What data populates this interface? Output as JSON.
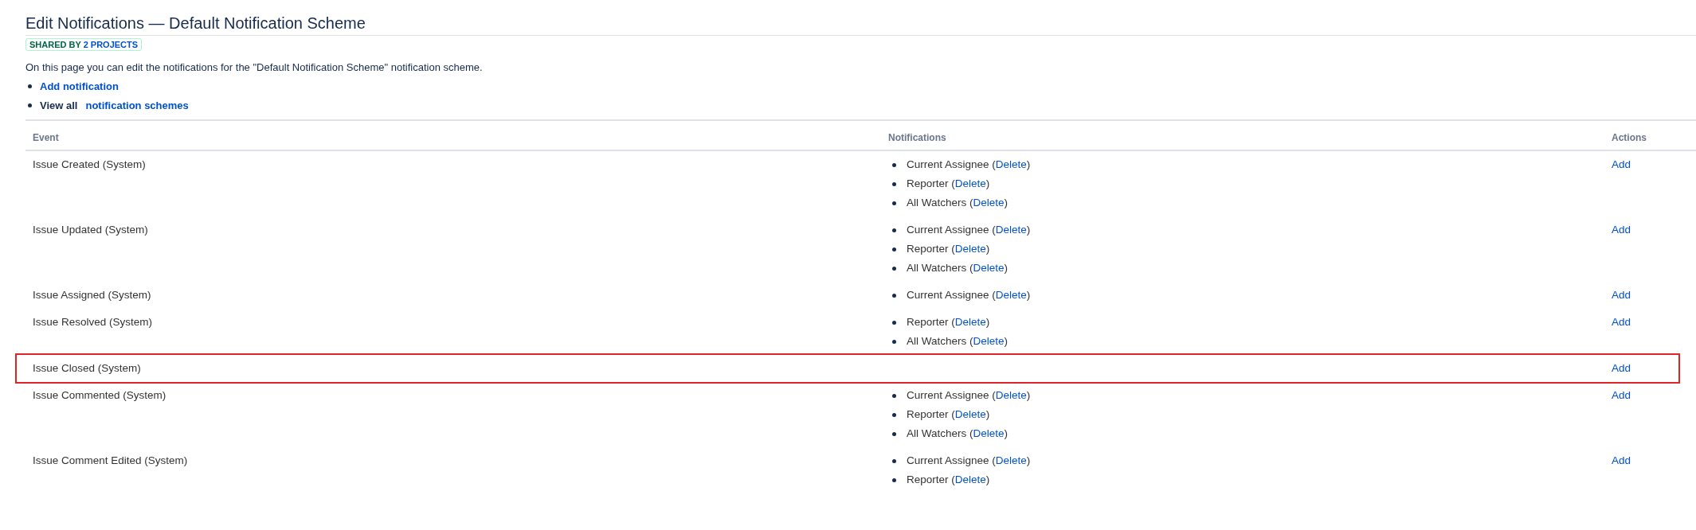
{
  "title": "Edit Notifications — Default Notification Scheme",
  "lozenge": {
    "label": "SHARED BY",
    "link": "2 PROJECTS"
  },
  "description": "On this page you can edit the notifications for the \"Default Notification Scheme\" notification scheme.",
  "links": [
    {
      "link": "Add notification"
    },
    {
      "prefix": "View all",
      "link": "notification schemes"
    }
  ],
  "table": {
    "columns": [
      "Event",
      "Notifications",
      "Actions"
    ],
    "rows": [
      {
        "event": "Issue Created (System)",
        "highlighted": false,
        "notifications": [
          {
            "name": "Current Assignee",
            "open": "(",
            "action": "Delete",
            "close": ")"
          },
          {
            "name": "Reporter",
            "open": "(",
            "action": "Delete",
            "close": ")"
          },
          {
            "name": "All Watchers",
            "open": "(",
            "action": "Delete",
            "close": ")"
          }
        ],
        "action": "Add"
      },
      {
        "event": "Issue Updated (System)",
        "highlighted": false,
        "notifications": [
          {
            "name": "Current Assignee",
            "open": "(",
            "action": "Delete",
            "close": ")"
          },
          {
            "name": "Reporter",
            "open": "(",
            "action": "Delete",
            "close": ")"
          },
          {
            "name": "All Watchers",
            "open": "(",
            "action": "Delete",
            "close": ")"
          }
        ],
        "action": "Add"
      },
      {
        "event": "Issue Assigned (System)",
        "highlighted": false,
        "notifications": [
          {
            "name": "Current Assignee",
            "open": "(",
            "action": "Delete",
            "close": ")"
          }
        ],
        "action": "Add"
      },
      {
        "event": "Issue Resolved (System)",
        "highlighted": false,
        "notifications": [
          {
            "name": "Reporter",
            "open": "(",
            "action": "Delete",
            "close": ")"
          },
          {
            "name": "All Watchers",
            "open": "(",
            "action": "Delete",
            "close": ")"
          }
        ],
        "action": "Add"
      },
      {
        "event": "Issue Closed (System)",
        "highlighted": true,
        "notifications": [],
        "action": "Add"
      },
      {
        "event": "Issue Commented (System)",
        "highlighted": false,
        "notifications": [
          {
            "name": "Current Assignee",
            "open": "(",
            "action": "Delete",
            "close": ")"
          },
          {
            "name": "Reporter",
            "open": "(",
            "action": "Delete",
            "close": ")"
          },
          {
            "name": "All Watchers",
            "open": "(",
            "action": "Delete",
            "close": ")"
          }
        ],
        "action": "Add"
      },
      {
        "event": "Issue Comment Edited (System)",
        "highlighted": false,
        "notifications": [
          {
            "name": "Current Assignee",
            "open": "(",
            "action": "Delete",
            "close": ")"
          },
          {
            "name": "Reporter",
            "open": "(",
            "action": "Delete",
            "close": ")"
          }
        ],
        "action": "Add"
      }
    ]
  }
}
